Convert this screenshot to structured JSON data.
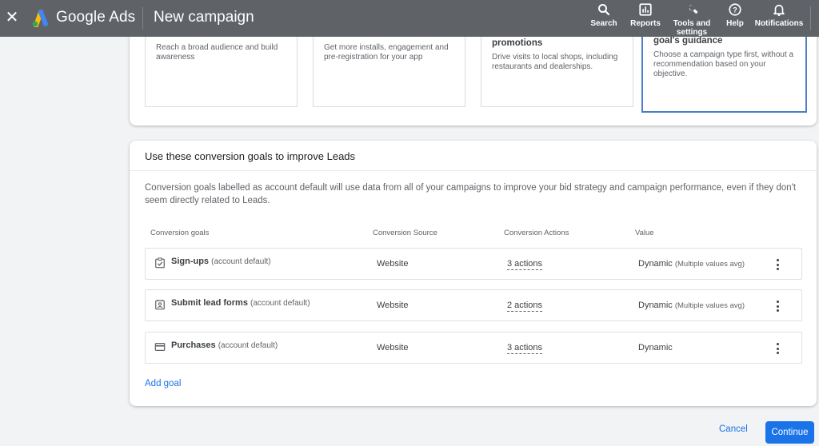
{
  "topbar": {
    "close_icon": "close-icon",
    "brand": "Google Ads",
    "page_title": "New campaign",
    "nav": [
      {
        "label": "Search",
        "icon": "search-icon"
      },
      {
        "label": "Reports",
        "icon": "reports-icon"
      },
      {
        "label": "Tools and settings",
        "icon": "wrench-icon"
      },
      {
        "label": "Help",
        "icon": "help-icon"
      },
      {
        "label": "Notifications",
        "icon": "bell-icon"
      }
    ]
  },
  "objectives": [
    {
      "title": "",
      "description": "Reach a broad audience and build awareness"
    },
    {
      "title": "",
      "description": "Get more installs, engagement and pre-registration for your app"
    },
    {
      "title": "promotions",
      "description": "Drive visits to local shops, including restaurants and dealerships."
    },
    {
      "title": "goal's guidance",
      "description": "Choose a campaign type first, without a recommendation based on your objective.",
      "selected": true
    }
  ],
  "goals_section": {
    "title": "Use these conversion goals to improve Leads",
    "intro": "Conversion goals labelled as account default will use data from all of your campaigns to improve your bid strategy and campaign performance, even if they don't seem directly related to Leads.",
    "columns": [
      "Conversion goals",
      "Conversion Source",
      "Conversion Actions",
      "Value"
    ],
    "rows": [
      {
        "icon": "clipboard-check-icon",
        "name": "Sign-ups",
        "tag": "(account default)",
        "source": "Website",
        "actions": "3 actions",
        "value": "Dynamic",
        "value_note": "(Multiple values avg)"
      },
      {
        "icon": "contact-form-icon",
        "name": "Submit lead forms",
        "tag": "(account default)",
        "source": "Website",
        "actions": "2 actions",
        "value": "Dynamic",
        "value_note": "(Multiple values avg)"
      },
      {
        "icon": "credit-card-icon",
        "name": "Purchases",
        "tag": "(account default)",
        "source": "Website",
        "actions": "3 actions",
        "value": "Dynamic",
        "value_note": ""
      }
    ],
    "add_goal": "Add goal"
  },
  "footer": {
    "cancel": "Cancel",
    "continue": "Continue"
  },
  "colors": {
    "topbar": "#5f6368",
    "accent": "#1a73e8",
    "selected_border": "#4a7ec6",
    "background": "#f1f3f4"
  }
}
